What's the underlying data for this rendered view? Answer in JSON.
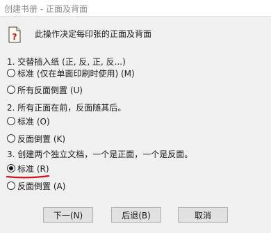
{
  "window": {
    "title": "创建书册 - 正面及背面"
  },
  "header": {
    "icon": "page-question-icon",
    "text": "此操作决定每印张的正面及背面"
  },
  "sections": [
    {
      "heading": "1. 交替插入纸 (正, 反, 正, 反...)",
      "options": [
        {
          "label": "标准 (仅在单面印刷时使用) (M)",
          "selected": false
        },
        {
          "label": "所有反面倒置 (U)",
          "selected": false
        }
      ]
    },
    {
      "heading": "2. 所有正面在前，反面随其后。",
      "options": [
        {
          "label": "标准 (O)",
          "selected": false
        },
        {
          "label": "反面倒置 (K)",
          "selected": false
        }
      ]
    },
    {
      "heading": "3. 创建两个独立文档，一个是正面，一个是反面。",
      "options": [
        {
          "label": "标准 (R)",
          "selected": true
        },
        {
          "label": "反面倒置 (A)",
          "selected": false
        }
      ]
    }
  ],
  "buttons": {
    "next": "下一(N)",
    "back": "后退(B)",
    "cancel": "取消"
  },
  "colors": {
    "annotation": "#d0121b",
    "background": "#f0f0f0"
  }
}
